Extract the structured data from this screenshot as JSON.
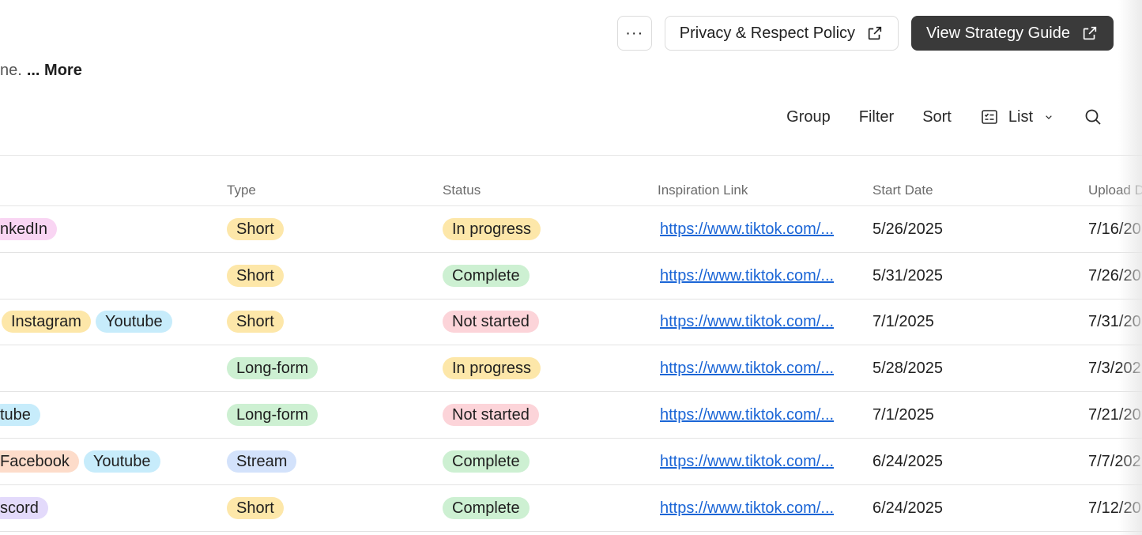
{
  "header": {
    "more_label": "···",
    "privacy_label": "Privacy & Respect Policy",
    "guide_label": "View Strategy Guide",
    "description_fragment": "ne.",
    "description_more": "... More"
  },
  "toolbar": {
    "group": "Group",
    "filter": "Filter",
    "sort": "Sort",
    "view": "List"
  },
  "table": {
    "columns": [
      "Type",
      "Status",
      "Inspiration Link",
      "Start Date",
      "Upload D"
    ],
    "rows": [
      {
        "platforms": [
          {
            "label": "nkedIn",
            "color": "#f9d5f3"
          }
        ],
        "type": {
          "label": "Short",
          "color": "#fde7a9"
        },
        "status": {
          "label": "In progress",
          "color": "#fde7a9"
        },
        "link": "https://www.tiktok.com/...",
        "start": "5/26/2025",
        "upload": "7/16/20"
      },
      {
        "platforms": [],
        "type": {
          "label": "Short",
          "color": "#fde7a9"
        },
        "status": {
          "label": "Complete",
          "color": "#cdf0d2"
        },
        "link": "https://www.tiktok.com/...",
        "start": "5/31/2025",
        "upload": "7/26/20"
      },
      {
        "platforms": [
          {
            "label": "Instagram",
            "color": "#fde7a9"
          },
          {
            "label": "Youtube",
            "color": "#c7ecfb"
          }
        ],
        "type": {
          "label": "Short",
          "color": "#fde7a9"
        },
        "status": {
          "label": "Not started",
          "color": "#fcd4d9"
        },
        "link": "https://www.tiktok.com/...",
        "start": "7/1/2025",
        "upload": "7/31/20"
      },
      {
        "platforms": [],
        "type": {
          "label": "Long-form",
          "color": "#cdf0d2"
        },
        "status": {
          "label": "In progress",
          "color": "#fde7a9"
        },
        "link": "https://www.tiktok.com/...",
        "start": "5/28/2025",
        "upload": "7/3/202"
      },
      {
        "platforms": [
          {
            "label": "tube",
            "color": "#c7ecfb"
          }
        ],
        "type": {
          "label": "Long-form",
          "color": "#cdf0d2"
        },
        "status": {
          "label": "Not started",
          "color": "#fcd4d9"
        },
        "link": "https://www.tiktok.com/...",
        "start": "7/1/2025",
        "upload": "7/21/20"
      },
      {
        "platforms": [
          {
            "label": "Facebook",
            "color": "#fddcca"
          },
          {
            "label": "Youtube",
            "color": "#c7ecfb"
          }
        ],
        "type": {
          "label": "Stream",
          "color": "#d3e2fb"
        },
        "status": {
          "label": "Complete",
          "color": "#cdf0d2"
        },
        "link": "https://www.tiktok.com/...",
        "start": "6/24/2025",
        "upload": "7/7/202"
      },
      {
        "platforms": [
          {
            "label": "scord",
            "color": "#e3dafb"
          }
        ],
        "type": {
          "label": "Short",
          "color": "#fde7a9"
        },
        "status": {
          "label": "Complete",
          "color": "#cdf0d2"
        },
        "link": "https://www.tiktok.com/...",
        "start": "6/24/2025",
        "upload": "7/12/20"
      }
    ]
  },
  "icons": {
    "external": "external-link-icon",
    "list": "list-view-icon",
    "chevron": "chevron-down-icon",
    "search": "search-icon"
  }
}
